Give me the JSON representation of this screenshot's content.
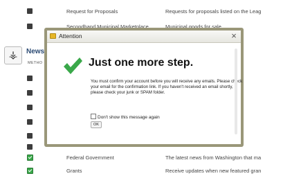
{
  "list_rows": [
    {
      "state": "dark",
      "name": "Request for Proposals",
      "desc": "Requests for proposals listed on the Leag"
    },
    {
      "state": "dark",
      "name": "Secondhand Municipal Marketplace",
      "desc": "Municipal goods for sale"
    },
    {
      "state": "dark",
      "name": "",
      "desc": ""
    },
    {
      "state": "dark",
      "name": "",
      "desc": ""
    },
    {
      "state": "dark",
      "name": "",
      "desc": ""
    },
    {
      "state": "dark",
      "name": "",
      "desc": ""
    },
    {
      "state": "dark",
      "name": "",
      "desc": ""
    },
    {
      "state": "dark",
      "name": "",
      "desc": ""
    },
    {
      "state": "green",
      "name": "Federal Government",
      "desc": "The latest news from Washington that ma"
    },
    {
      "state": "green",
      "name": "Grants",
      "desc": "Receive updates when new featured gran"
    }
  ],
  "news": {
    "label": "News",
    "method_label": "METHO"
  },
  "dialog": {
    "title": "Attention",
    "close": "×",
    "headline": "Just one more step.",
    "message": "You must confirm your account before you will receive any emails. Please check your email for the confirmation link. If you haven't received an email shortly, please check your junk or SPAM folder.",
    "dont_show_label": "Don't show this message again",
    "ok_label": "OK"
  },
  "colors": {
    "accent_green": "#3aa84a",
    "dialog_border": "#9a9779"
  }
}
